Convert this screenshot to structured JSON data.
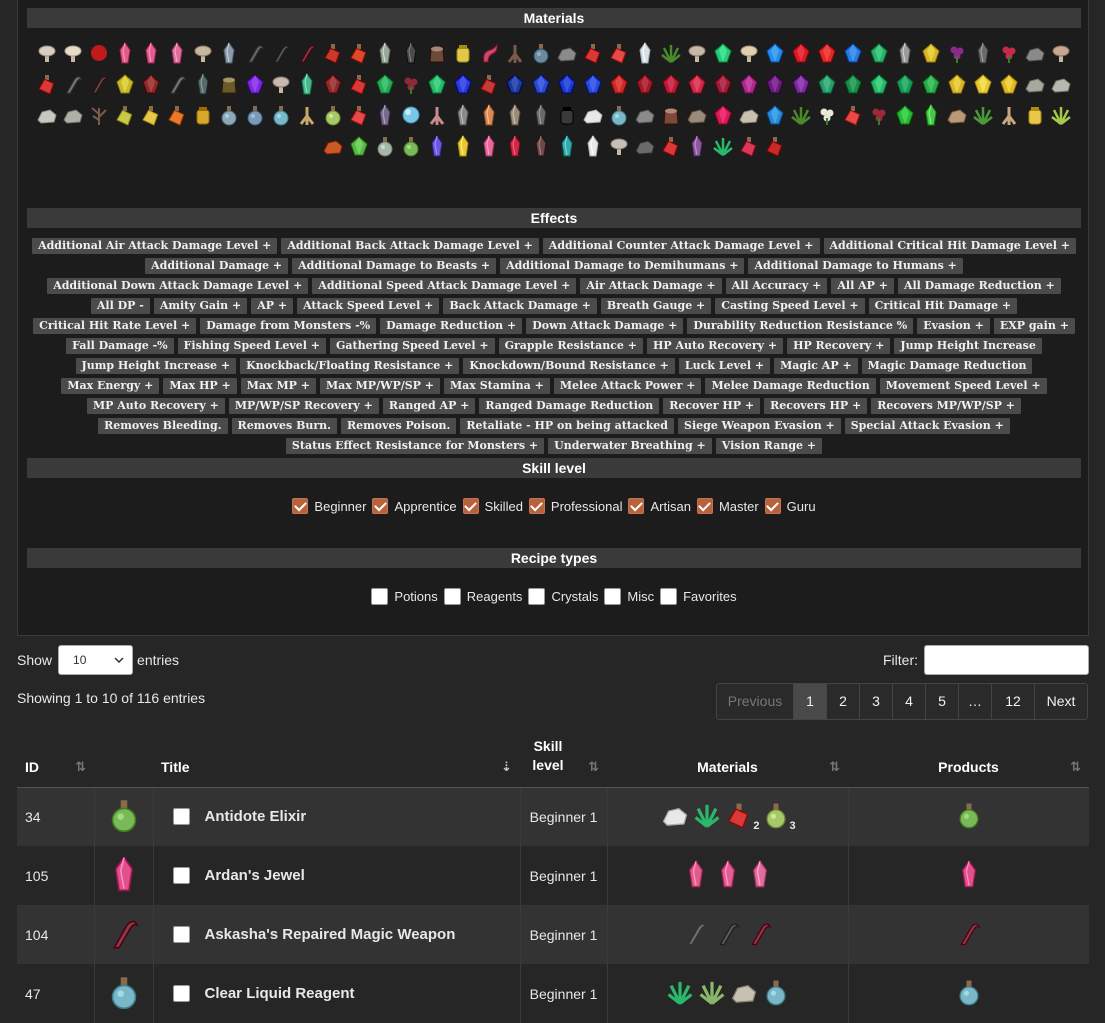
{
  "sections": {
    "materials": "Materials",
    "effects": "Effects",
    "skill_level": "Skill level",
    "recipe_types": "Recipe types"
  },
  "materials_icons": [
    [
      "mushroom",
      "#d8cfc0"
    ],
    [
      "mushroom",
      "#e6dcc8"
    ],
    [
      "apple",
      "#c11a1a"
    ],
    [
      "crystal",
      "#e05c8a"
    ],
    [
      "crystal",
      "#e35d90"
    ],
    [
      "crystal",
      "#e06d9a"
    ],
    [
      "mushroom",
      "#c8b8a0"
    ],
    [
      "crystal",
      "#8a9aa8"
    ],
    [
      "claw",
      "#6e6e6e"
    ],
    [
      "claw",
      "#5a5a5a"
    ],
    [
      "claw",
      "#8a3a4a"
    ],
    [
      "potion",
      "#c83a2a"
    ],
    [
      "potion",
      "#e04a2a"
    ],
    [
      "crystal",
      "#9aa89a"
    ],
    [
      "crystal",
      "#4a4a4a"
    ],
    [
      "stump",
      "#6a4a3a"
    ],
    [
      "jar",
      "#e0c84a"
    ],
    [
      "tail",
      "#c84a6a"
    ],
    [
      "root",
      "#7a5a4a"
    ],
    [
      "flask",
      "#6a8aa0"
    ],
    [
      "rock",
      "#8a8a8a"
    ],
    [
      "potion",
      "#d83a3a"
    ],
    [
      "potion",
      "#e84a4a"
    ],
    [
      "crystal",
      "#d8e0e8"
    ],
    [
      "moss",
      "#4a8a2a"
    ],
    [
      "mushroom",
      "#c8b8a8"
    ],
    [
      "gem",
      "#2ac87a"
    ],
    [
      "mushroom",
      "#e0d0b0"
    ],
    [
      "gem",
      "#2a8ae8"
    ],
    [
      "gem",
      "#d81a2a"
    ],
    [
      "gem",
      "#e02a2a"
    ],
    [
      "gem",
      "#2a7ae0"
    ],
    [
      "gem",
      "#2ab06a"
    ],
    [
      "crystal",
      "#9a9a9a"
    ],
    [
      "gem",
      "#d8b82a"
    ],
    [
      "flower",
      "#8a2a8a"
    ],
    [
      "crystal",
      "#6a6a6a"
    ],
    [
      "flower",
      "#c82a4a"
    ],
    [
      "rock",
      "#8a8a8a"
    ],
    [
      "mushroom",
      "#c8a890"
    ],
    [
      "potion",
      "#d83a3a"
    ],
    [
      "claw",
      "#7a7a7a"
    ],
    [
      "claw",
      "#6a4a4a"
    ],
    [
      "gem",
      "#c8b82a"
    ],
    [
      "gem",
      "#8a2a2a"
    ],
    [
      "claw",
      "#7a7a7a"
    ],
    [
      "crystal",
      "#5a6a6a"
    ],
    [
      "stump",
      "#6a5a2a"
    ],
    [
      "gem",
      "#7a2ad8"
    ],
    [
      "mushroom",
      "#c8b8b0"
    ],
    [
      "crystal",
      "#4ab88a"
    ],
    [
      "gem",
      "#8a2a2a"
    ],
    [
      "potion",
      "#d83a3a"
    ],
    [
      "gem",
      "#2aa85a"
    ],
    [
      "flower",
      "#8a2a3a"
    ],
    [
      "gem",
      "#2ab86a"
    ],
    [
      "gem",
      "#2a3ad8"
    ],
    [
      "potion",
      "#c83a3a"
    ],
    [
      "gem",
      "#1a3a9a"
    ],
    [
      "gem",
      "#2a4ac8"
    ],
    [
      "gem",
      "#1a3ac8"
    ],
    [
      "gem",
      "#2a4ad8"
    ],
    [
      "gem",
      "#c82a2a"
    ],
    [
      "gem",
      "#9a1a2a"
    ],
    [
      "gem",
      "#b81a3a"
    ],
    [
      "gem",
      "#c82a4a"
    ],
    [
      "gem",
      "#9a1a3a"
    ],
    [
      "gem",
      "#a82a8a"
    ],
    [
      "gem",
      "#6a1a7a"
    ],
    [
      "gem",
      "#7a2a9a"
    ],
    [
      "gem",
      "#2a9a6a"
    ],
    [
      "gem",
      "#1a8a4a"
    ],
    [
      "gem",
      "#2ab86a"
    ],
    [
      "gem",
      "#1a9a5a"
    ],
    [
      "gem",
      "#2aa84a"
    ],
    [
      "gem",
      "#d8b82a"
    ],
    [
      "gem",
      "#e8c83a"
    ],
    [
      "gem",
      "#e0b82a"
    ],
    [
      "rock",
      "#a8a8a0"
    ],
    [
      "rock",
      "#b8b8b0"
    ],
    [
      "rock",
      "#c8c8c0"
    ],
    [
      "rock",
      "#b0b0a8"
    ],
    [
      "branch",
      "#7a5a4a"
    ],
    [
      "potion",
      "#c8c84a"
    ],
    [
      "potion",
      "#e8c84a"
    ],
    [
      "potion",
      "#e87a2a"
    ],
    [
      "jar",
      "#d8a82a"
    ],
    [
      "flask",
      "#8aa8b8"
    ],
    [
      "flask",
      "#7a9ab8"
    ],
    [
      "flask",
      "#7ab8c8"
    ],
    [
      "root",
      "#c8a86a"
    ],
    [
      "flask",
      "#a8c86a"
    ],
    [
      "potion",
      "#e84a4a"
    ],
    [
      "crystal",
      "#7a6a8a"
    ],
    [
      "orb",
      "#7ac8e8"
    ],
    [
      "root",
      "#c88a8a"
    ],
    [
      "crystal",
      "#8a8a8a"
    ],
    [
      "crystal",
      "#d88a5a"
    ],
    [
      "crystal",
      "#9a8a7a"
    ],
    [
      "crystal",
      "#6a6a6a"
    ],
    [
      "jar",
      "#3a3a3a"
    ],
    [
      "rock",
      "#e8e8e8"
    ],
    [
      "flask",
      "#7ab8c8"
    ],
    [
      "rock",
      "#8a8a8a"
    ],
    [
      "stump",
      "#7a4a3a"
    ],
    [
      "rock",
      "#9a8a7a"
    ],
    [
      "gem",
      "#d81a5a"
    ],
    [
      "rock",
      "#c8c0b0"
    ],
    [
      "gem",
      "#2a8ad8"
    ],
    [
      "moss",
      "#4a8a2a"
    ],
    [
      "flower",
      "#e8e8d8"
    ],
    [
      "potion",
      "#e84a4a"
    ],
    [
      "flower",
      "#9a2a3a"
    ],
    [
      "gem",
      "#2ab83a"
    ],
    [
      "crystal",
      "#4ac84a"
    ],
    [
      "rock",
      "#b89a7a"
    ],
    [
      "moss",
      "#4a9a3a"
    ],
    [
      "root",
      "#c8a87a"
    ],
    [
      "jar",
      "#e8c84a"
    ],
    [
      "moss",
      "#a8c84a"
    ],
    [
      "rock",
      "#c85a2a"
    ],
    [
      "gem",
      "#5ab84a"
    ],
    [
      "flask",
      "#a8b8a8"
    ],
    [
      "flask",
      "#7ab85a"
    ],
    [
      "crystal",
      "#6a5ad8"
    ],
    [
      "crystal",
      "#e8c83a"
    ],
    [
      "crystal",
      "#e86a9a"
    ],
    [
      "crystal",
      "#c82a4a"
    ],
    [
      "crystal",
      "#6a4a4a"
    ],
    [
      "crystal",
      "#3aa8a8"
    ],
    [
      "crystal",
      "#e8e8e8"
    ],
    [
      "mushroom",
      "#c8c0b8"
    ],
    [
      "rock",
      "#6a6a6a"
    ],
    [
      "potion",
      "#d83a3a"
    ],
    [
      "crystal",
      "#8a5a9a"
    ],
    [
      "moss",
      "#2ab86a"
    ],
    [
      "potion",
      "#d83a5a"
    ],
    [
      "potion",
      "#c82a2a"
    ]
  ],
  "effects": [
    "Additional Air Attack Damage Level +",
    "Additional Back Attack Damage Level +",
    "Additional Counter Attack Damage Level +",
    "Additional Critical Hit Damage Level +",
    "Additional Damage +",
    "Additional Damage to Beasts +",
    "Additional Damage to Demihumans +",
    "Additional Damage to Humans +",
    "Additional Down Attack Damage Level +",
    "Additional Speed Attack Damage Level +",
    "Air Attack Damage +",
    "All Accuracy +",
    "All AP +",
    "All Damage Reduction +",
    "All DP -",
    "Amity Gain +",
    "AP +",
    "Attack Speed Level +",
    "Back Attack Damage +",
    "Breath Gauge +",
    "Casting Speed Level +",
    "Critical Hit Damage +",
    "Critical Hit Rate Level +",
    "Damage from Monsters -%",
    "Damage Reduction +",
    "Down Attack Damage +",
    "Durability Reduction Resistance %",
    "Evasion +",
    "EXP gain +",
    "Fall Damage -%",
    "Fishing Speed Level +",
    "Gathering Speed Level +",
    "Grapple Resistance +",
    "HP Auto Recovery +",
    "HP Recovery +",
    "Jump Height Increase",
    "Jump Height Increase +",
    "Knockback/Floating Resistance +",
    "Knockdown/Bound Resistance +",
    "Luck Level +",
    "Magic AP +",
    "Magic Damage Reduction",
    "Max Energy +",
    "Max HP +",
    "Max MP +",
    "Max MP/WP/SP +",
    "Max Stamina +",
    "Melee Attack Power +",
    "Melee Damage Reduction",
    "Movement Speed Level +",
    "MP Auto Recovery +",
    "MP/WP/SP Recovery +",
    "Ranged AP +",
    "Ranged Damage Reduction",
    "Recover HP +",
    "Recovers HP +",
    "Recovers MP/WP/SP +",
    "Removes Bleeding.",
    "Removes Burn.",
    "Removes Poison.",
    "Retaliate - HP on being attacked",
    "Siege Weapon Evasion +",
    "Special Attack Evasion +",
    "Status Effect Resistance for Monsters +",
    "Underwater Breathing +",
    "Vision Range +"
  ],
  "skill_levels": [
    "Beginner",
    "Apprentice",
    "Skilled",
    "Professional",
    "Artisan",
    "Master",
    "Guru"
  ],
  "recipe_types": [
    "Potions",
    "Reagents",
    "Crystals",
    "Misc",
    "Favorites"
  ],
  "controls": {
    "show_label": "Show",
    "entries_label": "entries",
    "page_length": "10",
    "filter_label": "Filter:",
    "info": "Showing 1 to 10 of 116 entries"
  },
  "pagination": [
    "Previous",
    "1",
    "2",
    "3",
    "4",
    "5",
    "…",
    "12",
    "Next"
  ],
  "table": {
    "headers": {
      "id": "ID",
      "title": "Title",
      "skill_level": "Skill level",
      "materials": "Materials",
      "products": "Products"
    },
    "rows": [
      {
        "id": "34",
        "title": "Antidote Elixir",
        "level": "Beginner 1",
        "icon": [
          "flask",
          "#7ab85a"
        ],
        "materials": [
          {
            "icon": [
              "rock",
              "#e8e8e8"
            ],
            "qty": ""
          },
          {
            "icon": [
              "moss",
              "#2ab86a"
            ],
            "qty": ""
          },
          {
            "icon": [
              "potion",
              "#d83a3a"
            ],
            "qty": "2"
          },
          {
            "icon": [
              "flask",
              "#a8c86a"
            ],
            "qty": "3"
          }
        ],
        "product": [
          "flask",
          "#7ab85a"
        ]
      },
      {
        "id": "105",
        "title": "Ardan's Jewel",
        "level": "Beginner 1",
        "icon": [
          "crystal",
          "#e0508a"
        ],
        "materials": [
          {
            "icon": [
              "crystal",
              "#e05c8a"
            ],
            "qty": ""
          },
          {
            "icon": [
              "crystal",
              "#e35d90"
            ],
            "qty": ""
          },
          {
            "icon": [
              "crystal",
              "#e06d9a"
            ],
            "qty": ""
          }
        ],
        "product": [
          "crystal",
          "#e0508a"
        ]
      },
      {
        "id": "104",
        "title": "Askasha's Repaired Magic Weapon",
        "level": "Beginner 1",
        "icon": [
          "claw",
          "#8a3a4a"
        ],
        "materials": [
          {
            "icon": [
              "claw",
              "#6e6e6e"
            ],
            "qty": ""
          },
          {
            "icon": [
              "claw",
              "#5a5a5a"
            ],
            "qty": ""
          },
          {
            "icon": [
              "claw",
              "#8a3a4a"
            ],
            "qty": ""
          }
        ],
        "product": [
          "claw",
          "#8a3a4a"
        ]
      },
      {
        "id": "47",
        "title": "Clear Liquid Reagent",
        "level": "Beginner 1",
        "icon": [
          "flask",
          "#7ab8c8"
        ],
        "materials": [
          {
            "icon": [
              "moss",
              "#2ab86a"
            ],
            "qty": ""
          },
          {
            "icon": [
              "moss",
              "#8ab86a"
            ],
            "qty": ""
          },
          {
            "icon": [
              "rock",
              "#c8c0b0"
            ],
            "qty": ""
          },
          {
            "icon": [
              "flask",
              "#7ab8c8"
            ],
            "qty": ""
          }
        ],
        "product": [
          "flask",
          "#7ab8c8"
        ]
      }
    ]
  }
}
